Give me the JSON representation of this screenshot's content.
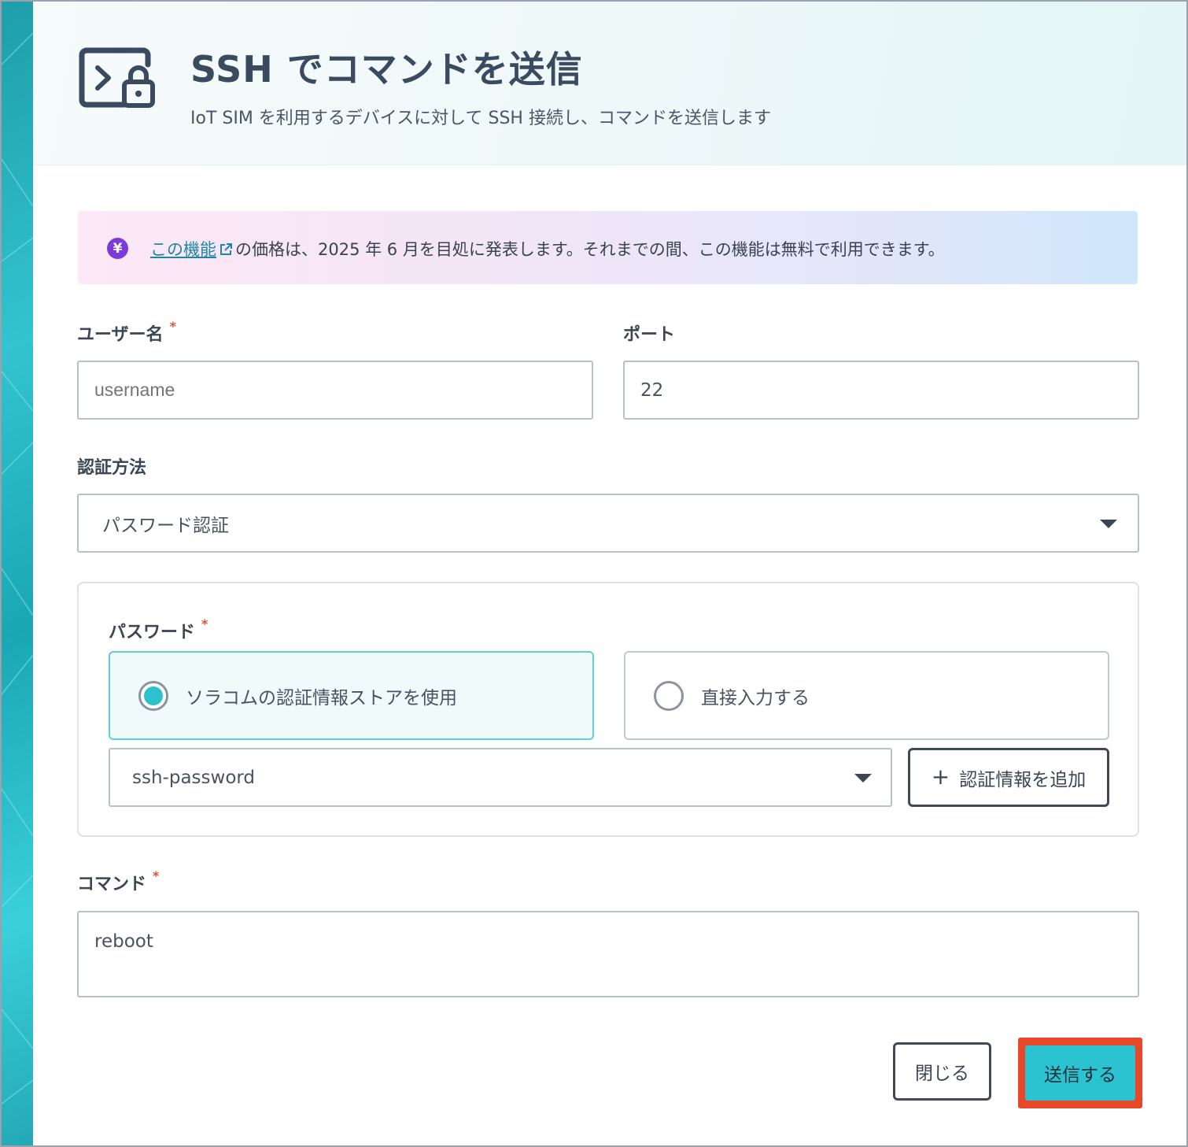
{
  "header": {
    "title": "SSH でコマンドを送信",
    "subtitle": "IoT SIM を利用するデバイスに対して SSH 接続し、コマンドを送信します",
    "icon": "terminal-lock-icon"
  },
  "notice": {
    "badge": "¥",
    "link_text": "この機能",
    "text": "の価格は、2025 年 6 月を目処に発表します。それまでの間、この機能は無料で利用できます。"
  },
  "form": {
    "username": {
      "label": "ユーザー名",
      "required_mark": "*",
      "placeholder": "username",
      "value": ""
    },
    "port": {
      "label": "ポート",
      "value": "22"
    },
    "auth_method": {
      "label": "認証方法",
      "selected": "パスワード認証"
    },
    "password": {
      "label": "パスワード",
      "required_mark": "*",
      "options": [
        {
          "label": "ソラコムの認証情報ストアを使用",
          "selected": true
        },
        {
          "label": "直接入力する",
          "selected": false
        }
      ],
      "credential_selected": "ssh-password",
      "add_credential_label": "認証情報を追加",
      "add_credential_icon": "+"
    },
    "command": {
      "label": "コマンド",
      "required_mark": "*",
      "value": "reboot"
    }
  },
  "footer": {
    "close_label": "閉じる",
    "send_label": "送信する"
  },
  "colors": {
    "accent": "#2bc3cf",
    "highlight_border": "#e9472a",
    "badge": "#7b3ad9",
    "required": "#e0533b",
    "link": "#1f84a6"
  }
}
